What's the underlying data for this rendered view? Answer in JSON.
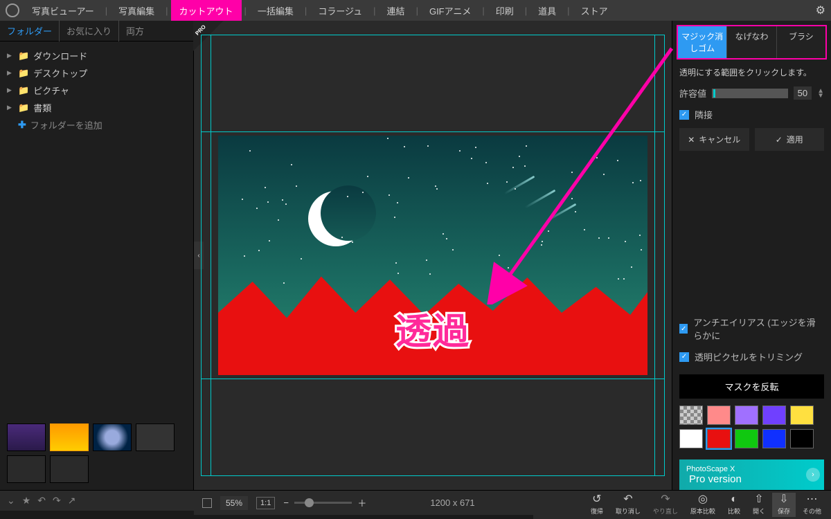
{
  "main_tabs": {
    "items": [
      "写真ビューアー",
      "写真編集",
      "カットアウト",
      "一括編集",
      "コラージュ",
      "連結",
      "GIFアニメ",
      "印刷",
      "道具",
      "ストア"
    ],
    "active_index": 2
  },
  "left": {
    "tabs": [
      "フォルダー",
      "お気に入り",
      "両方"
    ],
    "active_index": 0,
    "folders": [
      "ダウンロード",
      "デスクトップ",
      "ピクチャ",
      "書類"
    ],
    "add_label": "フォルダーを追加"
  },
  "canvas": {
    "overlay_text": "透過",
    "pro_badge": "PRO",
    "dims": "1200 x 671",
    "zoom_pct": "55%",
    "ratio": "1:1"
  },
  "right": {
    "tool_tabs": [
      "マジック消しゴム",
      "なげなわ",
      "ブラシ"
    ],
    "active_tool": 0,
    "hint": "透明にする範囲をクリックします。",
    "tolerance_label": "許容値",
    "tolerance_value": "50",
    "contiguous_label": "隣接",
    "cancel": "キャンセル",
    "apply": "適用",
    "antialias": "アンチエイリアス (エッジを滑らかに",
    "trim": "透明ピクセルをトリミング",
    "invert": "マスクを反転",
    "swatches": [
      {
        "name": "transparent",
        "css": "sw-trans"
      },
      {
        "name": "pink",
        "color": "#ff8a8a"
      },
      {
        "name": "purple",
        "color": "#a070ff"
      },
      {
        "name": "violet",
        "color": "#7040ff"
      },
      {
        "name": "yellow",
        "color": "#ffe040"
      },
      {
        "name": "white",
        "color": "#ffffff"
      },
      {
        "name": "red",
        "color": "#e81010",
        "selected": true
      },
      {
        "name": "green",
        "color": "#10c810"
      },
      {
        "name": "blue",
        "color": "#1030ff"
      },
      {
        "name": "black",
        "color": "#000000"
      }
    ],
    "pro_banner_small": "PhotoScape X",
    "pro_banner_big": "Pro version"
  },
  "footer": {
    "undo_actions": [
      "復帰",
      "取り消し",
      "やり直し",
      "原本比較",
      "比較",
      "開く",
      "保存",
      "その他"
    ]
  }
}
